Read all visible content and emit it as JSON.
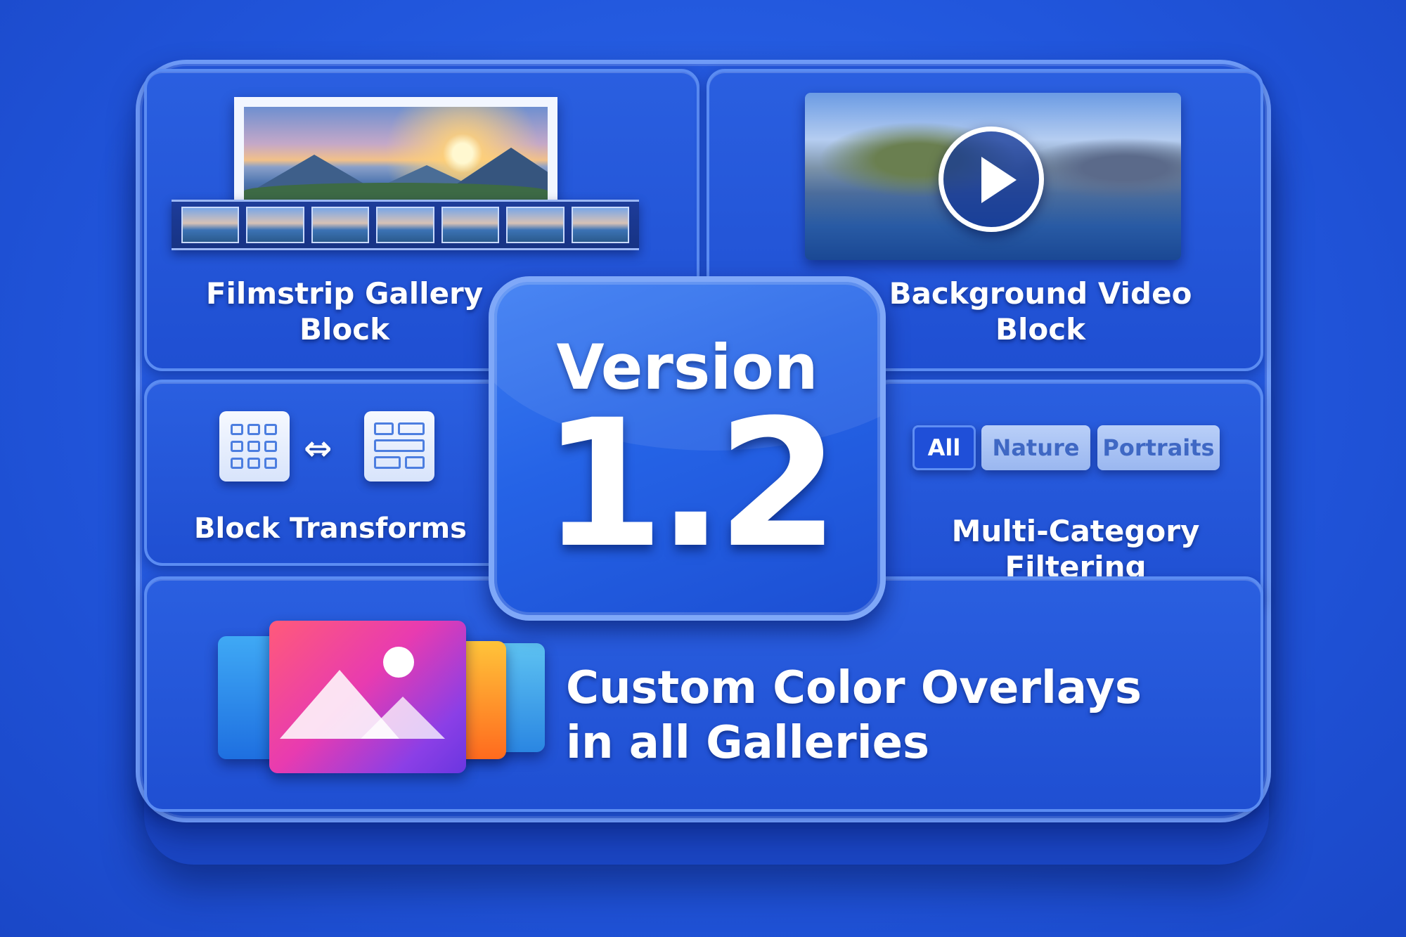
{
  "version": {
    "title": "Version",
    "number": "1.2"
  },
  "features": {
    "filmstrip": {
      "label_line1": "Filmstrip Gallery",
      "label_line2": "Block"
    },
    "video": {
      "label_line1": "Background Video",
      "label_line2": "Block"
    },
    "transforms": {
      "label": "Block Transforms"
    },
    "filtering": {
      "pills": [
        "All",
        "Nature",
        "Portraits"
      ],
      "active": "All",
      "label_line1": "Multi-Category",
      "label_line2": "Filtering"
    },
    "overlays": {
      "label_line1": "Custom Color Overlays",
      "label_line2": "in all Galleries"
    }
  },
  "colors": {
    "background": "#2156dc",
    "panel_border": "#5b8cf2",
    "accent": "#1f4fd8"
  },
  "icons": [
    "play-icon",
    "grid-layout-icon",
    "swap-arrows-icon",
    "rows-layout-icon",
    "image-icon"
  ]
}
